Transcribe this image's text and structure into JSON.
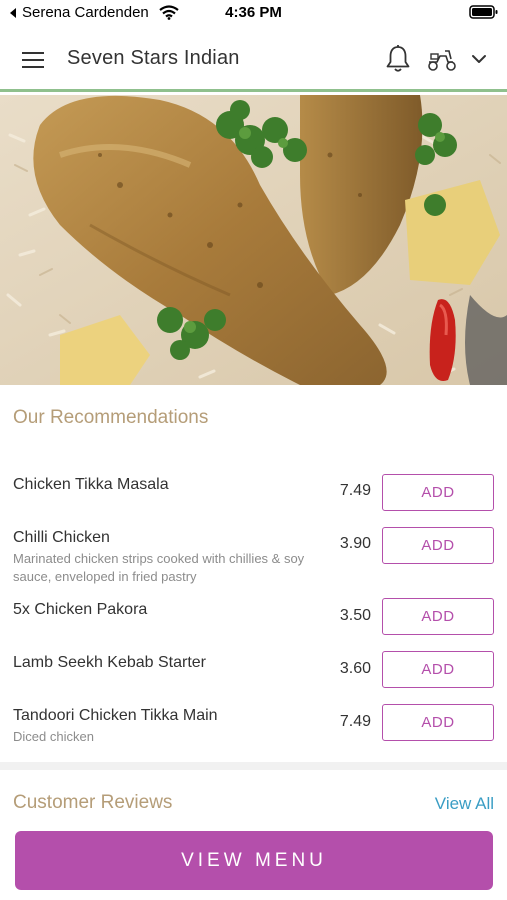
{
  "status_bar": {
    "back_label": "Serena Cardenden",
    "time": "4:36 PM"
  },
  "header": {
    "title": "Seven Stars Indian",
    "icons": [
      "hamburger-menu-icon",
      "bell-icon",
      "scooter-icon",
      "chevron-down-icon"
    ]
  },
  "recommendations": {
    "title": "Our Recommendations",
    "items": [
      {
        "name": "Chicken Tikka Masala",
        "description": "",
        "price": "7.49",
        "button": "ADD"
      },
      {
        "name": "Chilli Chicken",
        "description": "Marinated chicken strips cooked with chillies & soy sauce, enveloped in fried pastry",
        "price": "3.90",
        "button": "ADD"
      },
      {
        "name": "5x Chicken Pakora",
        "description": "",
        "price": "3.50",
        "button": "ADD"
      },
      {
        "name": "Lamb Seekh Kebab Starter",
        "description": "",
        "price": "3.60",
        "button": "ADD"
      },
      {
        "name": "Tandoori Chicken Tikka Main",
        "description": "Diced chicken",
        "price": "7.49",
        "button": "ADD"
      }
    ]
  },
  "reviews": {
    "title": "Customer Reviews",
    "view_all": "View All"
  },
  "footer": {
    "view_menu_label": "VIEW MENU"
  },
  "colors": {
    "accent": "#b44fab",
    "section_title": "#b59d78",
    "link": "#3a9dc4",
    "header_border": "#8fc08d"
  }
}
